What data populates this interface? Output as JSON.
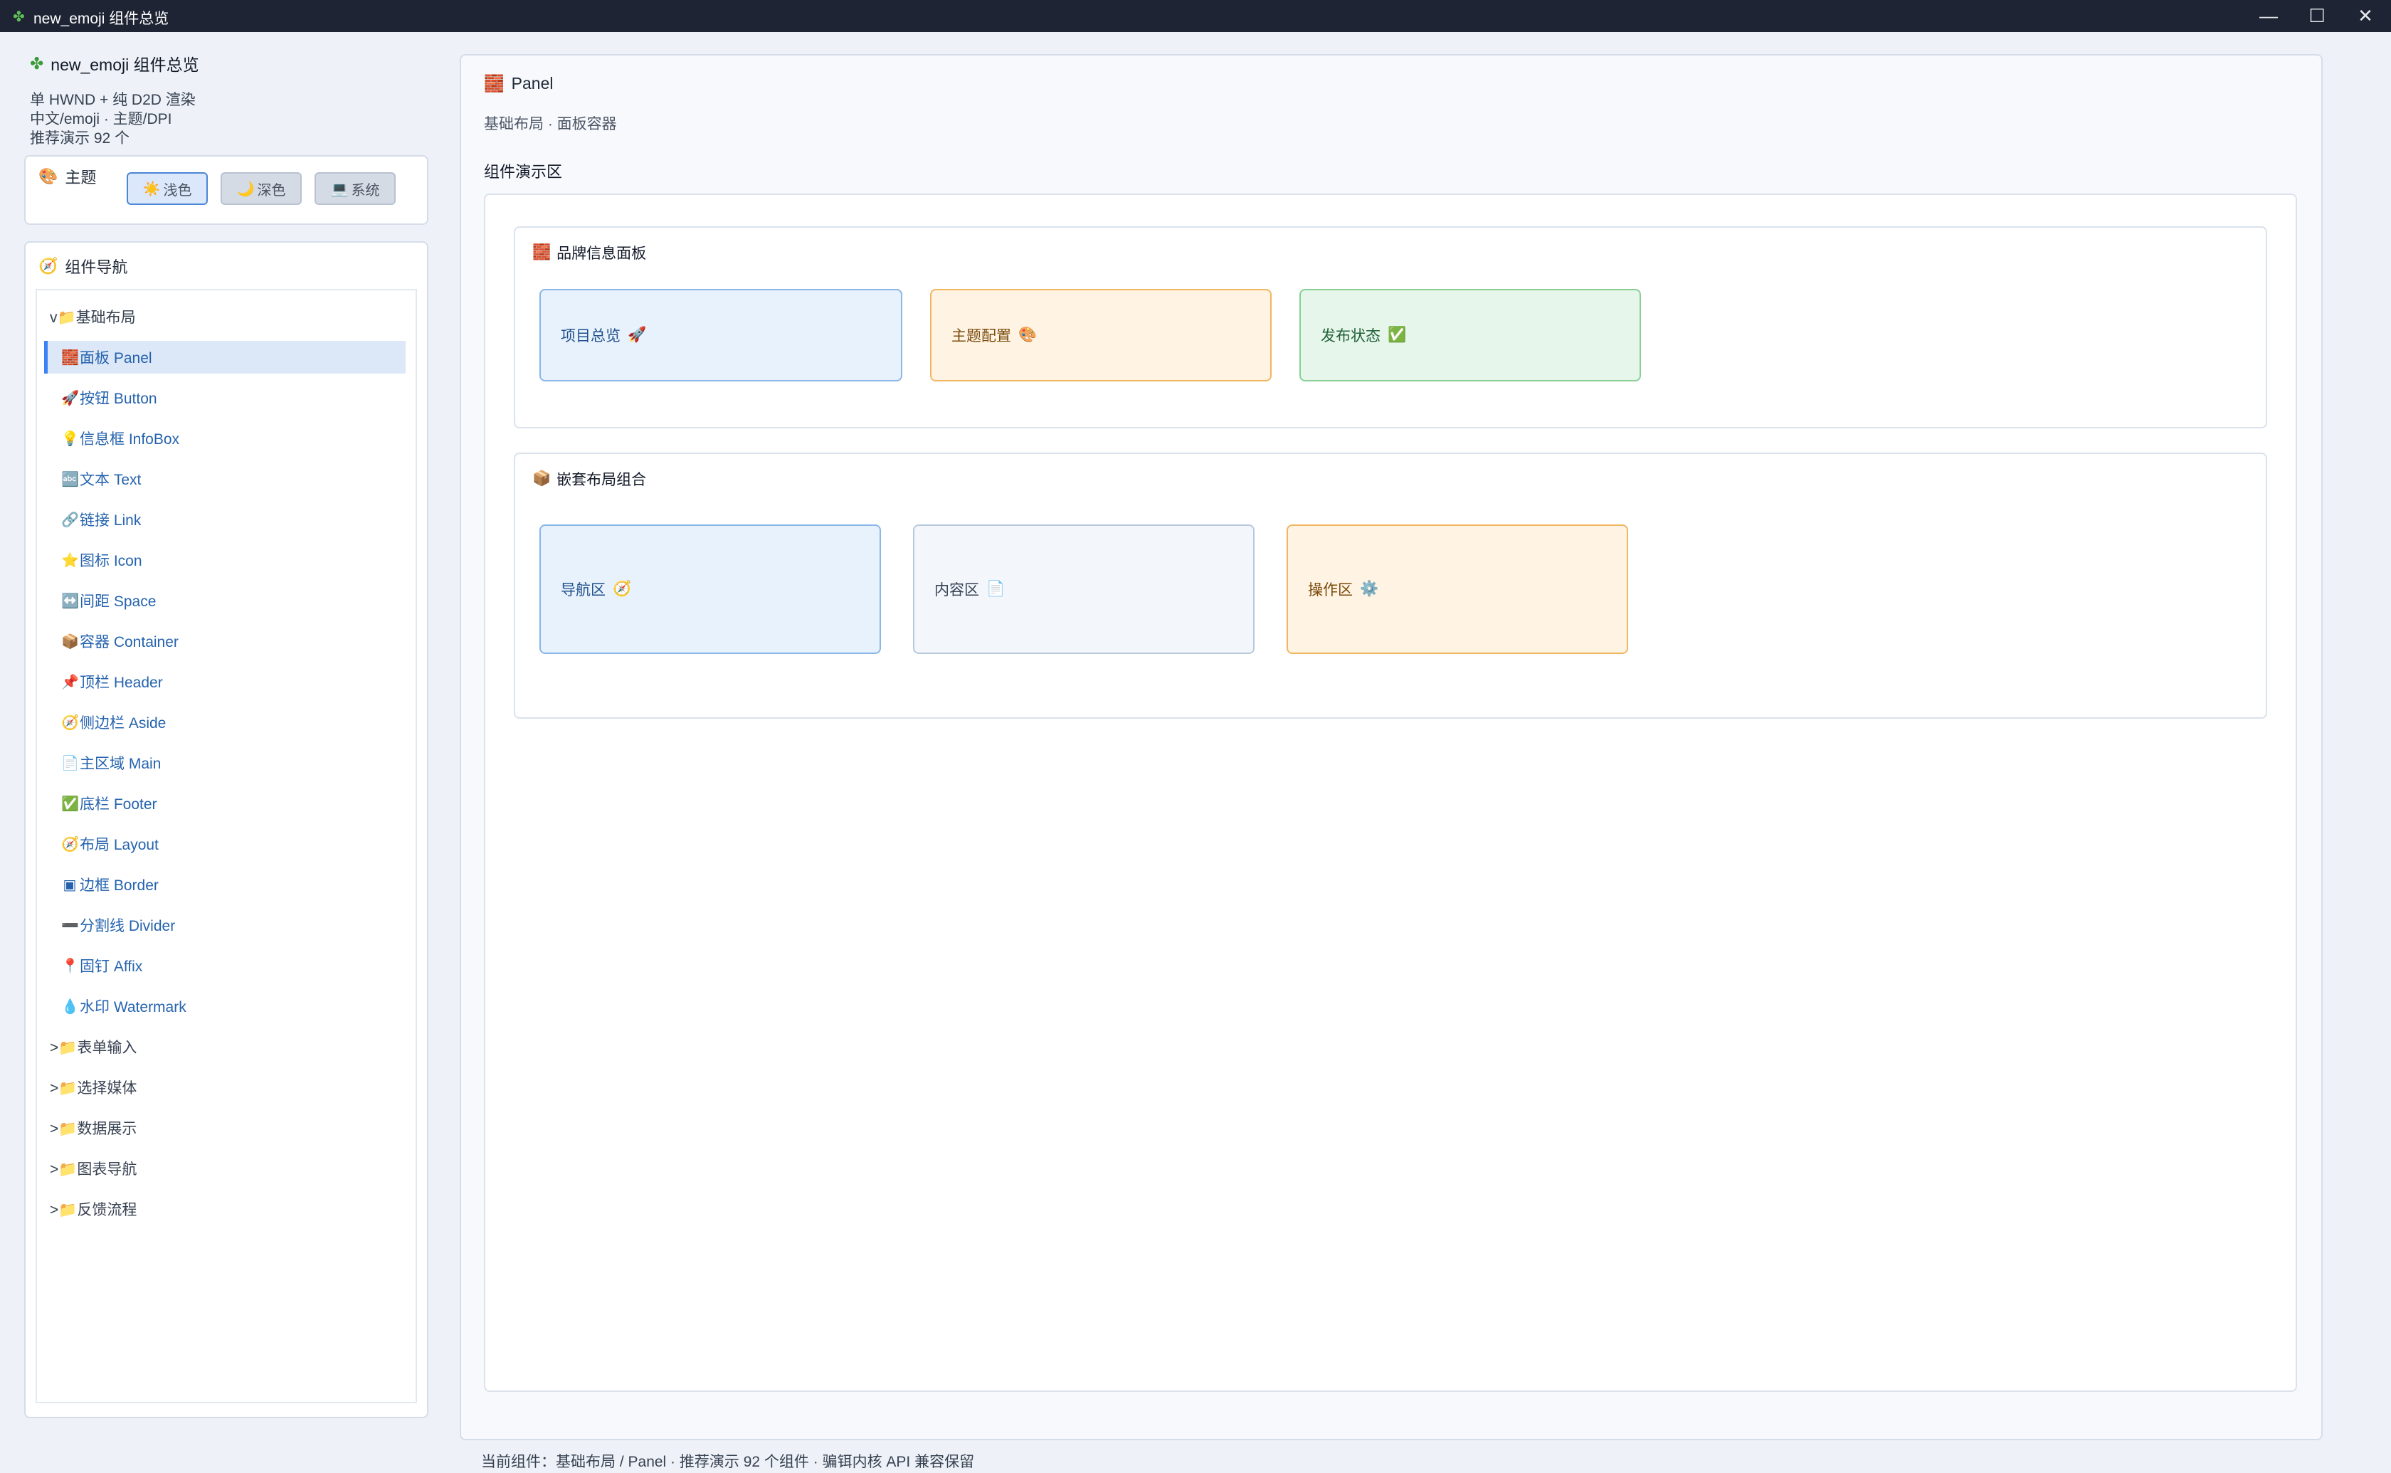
{
  "window": {
    "title": "new_emoji 组件总览",
    "minimize_glyph": "—",
    "maximize_glyph": "☐",
    "close_glyph": "✕"
  },
  "sidebar": {
    "title": "new_emoji 组件总览",
    "subtitle_lines": [
      "单 HWND + 纯 D2D 渲染",
      "中文/emoji · 主题/DPI",
      "推荐演示 92 个"
    ],
    "theme": {
      "label": "主题",
      "buttons": [
        {
          "label": "浅色",
          "icon": "☀️",
          "active": true
        },
        {
          "label": "深色",
          "icon": "🌙",
          "active": false
        },
        {
          "label": "系统",
          "icon": "💻",
          "active": false
        }
      ]
    },
    "nav": {
      "label": "组件导航",
      "items": [
        {
          "label": "v📁基础布局",
          "level": 0
        },
        {
          "label": "面板 Panel",
          "icon": "🧱",
          "level": 1,
          "selected": true
        },
        {
          "label": "按钮 Button",
          "icon": "🚀",
          "level": 1
        },
        {
          "label": "信息框 InfoBox",
          "icon": "💡",
          "level": 1
        },
        {
          "label": "文本 Text",
          "icon": "🔤",
          "level": 1
        },
        {
          "label": "链接 Link",
          "icon": "🔗",
          "level": 1
        },
        {
          "label": "图标 Icon",
          "icon": "⭐",
          "level": 1
        },
        {
          "label": "间距 Space",
          "icon": "↔️",
          "level": 1
        },
        {
          "label": "容器 Container",
          "icon": "📦",
          "level": 1
        },
        {
          "label": "顶栏 Header",
          "icon": "📌",
          "level": 1
        },
        {
          "label": "侧边栏 Aside",
          "icon": "🧭",
          "level": 1
        },
        {
          "label": "主区域 Main",
          "icon": "📄",
          "level": 1
        },
        {
          "label": "底栏 Footer",
          "icon": "✅",
          "level": 1
        },
        {
          "label": "布局 Layout",
          "icon": "🧭",
          "level": 1
        },
        {
          "label": "边框 Border",
          "icon": "▣",
          "level": 1
        },
        {
          "label": "分割线 Divider",
          "icon": "➖",
          "level": 1
        },
        {
          "label": "固钉 Affix",
          "icon": "📍",
          "level": 1
        },
        {
          "label": "水印 Watermark",
          "icon": "💧",
          "level": 1
        },
        {
          "label": ">📁表单输入",
          "level": 0
        },
        {
          "label": ">📁选择媒体",
          "level": 0
        },
        {
          "label": ">📁数据展示",
          "level": 0
        },
        {
          "label": ">📁图表导航",
          "level": 0
        },
        {
          "label": ">📁反馈流程",
          "level": 0
        }
      ]
    }
  },
  "main": {
    "title": "Panel",
    "title_icon": "🧱",
    "subtitle": "基础布局 · 面板容器",
    "demo_label": "组件演示区",
    "groups": [
      {
        "title": "品牌信息面板",
        "icon": "🧱",
        "tiles": [
          {
            "label": "项目总览",
            "icon": "🚀"
          },
          {
            "label": "主题配置",
            "icon": "🎨"
          },
          {
            "label": "发布状态",
            "icon": "✅"
          }
        ]
      },
      {
        "title": "嵌套布局组合",
        "icon": "📦",
        "tiles": [
          {
            "label": "导航区",
            "icon": "🧭"
          },
          {
            "label": "内容区",
            "icon": "📄"
          },
          {
            "label": "操作区",
            "icon": "⚙️"
          }
        ]
      }
    ]
  },
  "status_bar": {
    "text": "当前组件：基础布局 / Panel · 推荐演示 92 个组件 · 骗铒内核 API 兼容保留"
  },
  "colors": {
    "titlebar": "#1e2433",
    "accent": "#3b82f6",
    "selected_bg": "#dce7f7"
  }
}
